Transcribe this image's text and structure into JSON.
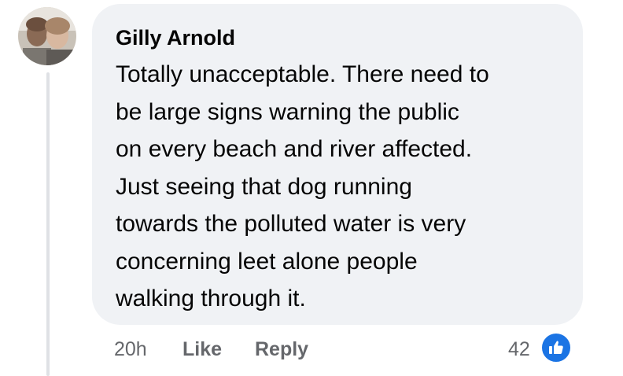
{
  "comment": {
    "author": "Gilly Arnold",
    "lines": [
      "Totally unacceptable. There need to",
      "be large signs warning the public",
      "on every beach and river affected.",
      "Just seeing that dog running",
      "towards the polluted water is very",
      "concerning leet alone people",
      "walking through it."
    ],
    "avatar_icon": "profile-photo"
  },
  "actions": {
    "time": "20h",
    "like_label": "Like",
    "reply_label": "Reply"
  },
  "reactions": {
    "count": "42",
    "type_icon": "like-thumbs-up-icon",
    "badge_color": "#1b74e4"
  },
  "colors": {
    "bubble_bg": "#f0f2f5",
    "text": "#050505",
    "meta_text": "#65676b"
  }
}
